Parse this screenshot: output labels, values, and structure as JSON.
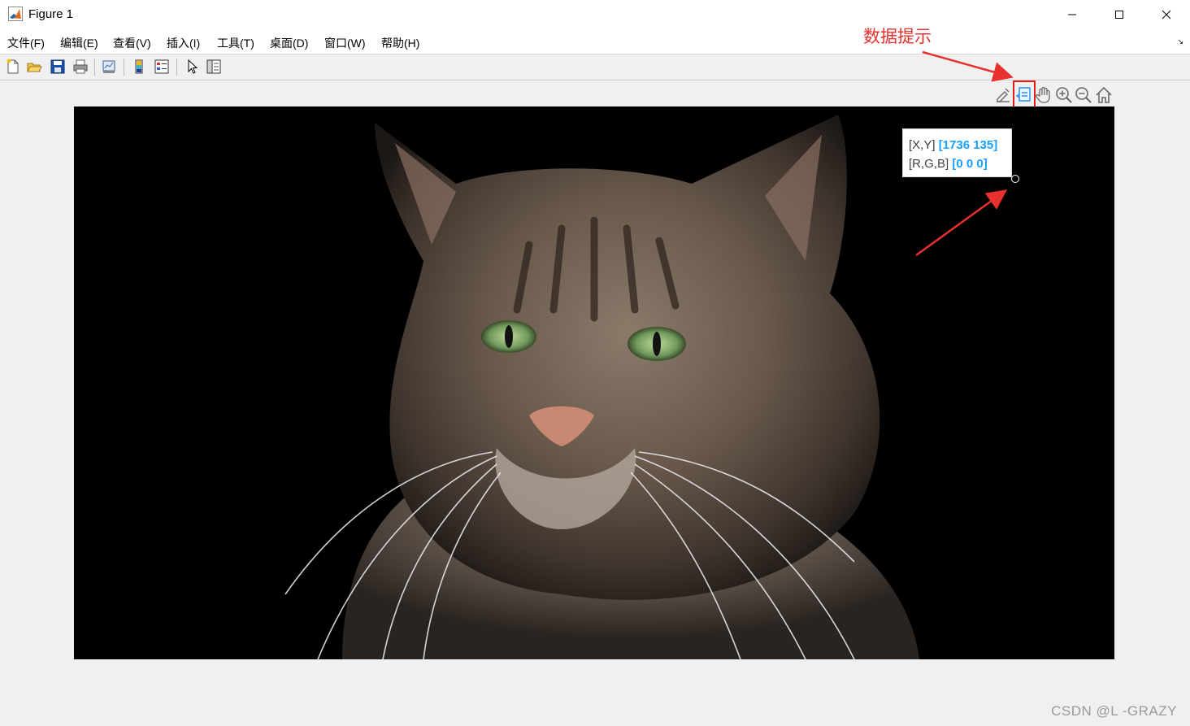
{
  "window": {
    "title": "Figure 1",
    "controls": {
      "minimize": "—",
      "maximize": "☐",
      "close": "✕"
    }
  },
  "menu": {
    "items": [
      {
        "label": "文件(F)"
      },
      {
        "label": "编辑(E)"
      },
      {
        "label": "查看(V)"
      },
      {
        "label": "插入(I)"
      },
      {
        "label": "工具(T)"
      },
      {
        "label": "桌面(D)"
      },
      {
        "label": "窗口(W)"
      },
      {
        "label": "帮助(H)"
      }
    ],
    "dock_arrow": "↘"
  },
  "toolbar": {
    "buttons": [
      "new-figure-icon",
      "open-file-icon",
      "save-icon",
      "print-icon",
      "link-plot-icon",
      "colorbar-icon",
      "legend-icon",
      "pointer-icon",
      "property-inspector-icon"
    ]
  },
  "axes_toolbar": {
    "buttons": [
      "brush-icon",
      "datatip-icon",
      "pan-icon",
      "zoom-in-icon",
      "zoom-out-icon",
      "home-icon"
    ],
    "active": "datatip-icon"
  },
  "datatip": {
    "xy_label": "[X,Y]",
    "xy_value": "[1736 135]",
    "rgb_label": "[R,G,B]",
    "rgb_value": "[0 0 0]"
  },
  "annotation": {
    "label": "数据提示",
    "color": "#e8302e"
  },
  "image": {
    "subject": "cat-photo"
  },
  "watermark": "CSDN @L -GRAZY"
}
